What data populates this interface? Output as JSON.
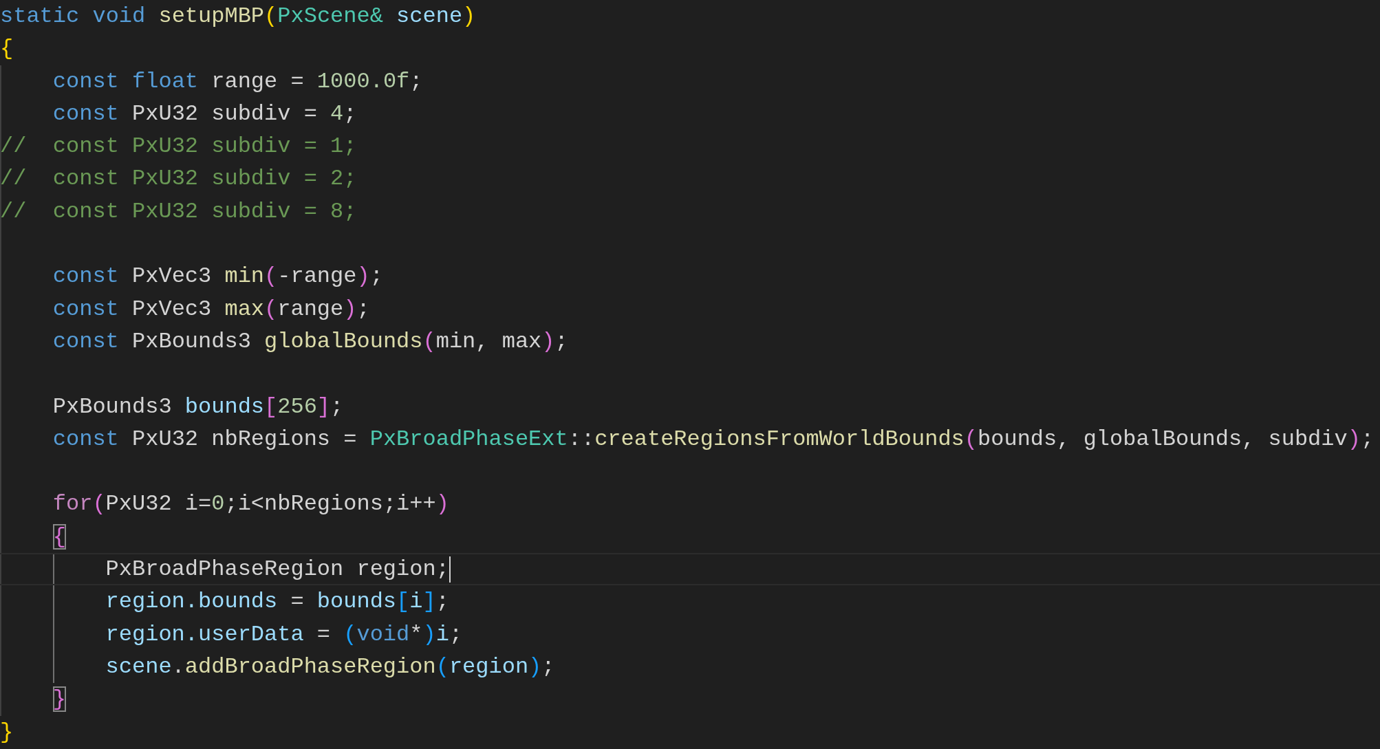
{
  "editor": {
    "lines": [
      {
        "kind": "code",
        "tokens": [
          {
            "kind": "keyword",
            "text": "static"
          },
          {
            "kind": "keyword",
            "text": " void"
          },
          {
            "kind": "function",
            "text": " setupMBP"
          },
          {
            "kind": "open",
            "text": "("
          },
          {
            "kind": "type",
            "text": "PxScene&"
          },
          {
            "kind": "variable",
            "text": " scene"
          },
          {
            "kind": "close",
            "text": ")"
          }
        ]
      },
      {
        "kind": "code",
        "tokens": [
          {
            "kind": "open",
            "text": "{"
          }
        ]
      },
      {
        "kind": "code",
        "tokens": [
          {
            "kind": "keyword",
            "text": "const"
          },
          {
            "kind": "keyword",
            "text": " float"
          },
          {
            "kind": "plain",
            "text": " range = "
          },
          {
            "kind": "number",
            "text": "1000.0f"
          },
          {
            "kind": "plain",
            "text": ";"
          }
        ]
      },
      {
        "kind": "code",
        "tokens": [
          {
            "kind": "keyword",
            "text": "const"
          },
          {
            "kind": "plain",
            "text": " PxU32 subdiv = "
          },
          {
            "kind": "number",
            "text": "4"
          },
          {
            "kind": "plain",
            "text": ";"
          }
        ]
      },
      {
        "kind": "comment",
        "text": "//  const PxU32 subdiv = 1;"
      },
      {
        "kind": "comment",
        "text": "//  const PxU32 subdiv = 2;"
      },
      {
        "kind": "comment",
        "text": "//  const PxU32 subdiv = 8;"
      },
      {
        "kind": "blank"
      },
      {
        "kind": "code",
        "tokens": [
          {
            "kind": "keyword",
            "text": "const"
          },
          {
            "kind": "plain",
            "text": " PxVec3 "
          },
          {
            "kind": "function",
            "text": "min"
          },
          {
            "kind": "open",
            "text": "("
          },
          {
            "kind": "plain",
            "text": "-range"
          },
          {
            "kind": "close",
            "text": ")"
          },
          {
            "kind": "plain",
            "text": ";"
          }
        ]
      },
      {
        "kind": "code",
        "tokens": [
          {
            "kind": "keyword",
            "text": "const"
          },
          {
            "kind": "plain",
            "text": " PxVec3 "
          },
          {
            "kind": "function",
            "text": "max"
          },
          {
            "kind": "open",
            "text": "("
          },
          {
            "kind": "plain",
            "text": "range"
          },
          {
            "kind": "close",
            "text": ")"
          },
          {
            "kind": "plain",
            "text": ";"
          }
        ]
      },
      {
        "kind": "code",
        "tokens": [
          {
            "kind": "keyword",
            "text": "const"
          },
          {
            "kind": "plain",
            "text": " PxBounds3 "
          },
          {
            "kind": "function",
            "text": "globalBounds"
          },
          {
            "kind": "open",
            "text": "("
          },
          {
            "kind": "plain",
            "text": "min, max"
          },
          {
            "kind": "close",
            "text": ")"
          },
          {
            "kind": "plain",
            "text": ";"
          }
        ]
      },
      {
        "kind": "blank"
      },
      {
        "kind": "code",
        "tokens": [
          {
            "kind": "plain",
            "text": "PxBounds3 "
          },
          {
            "kind": "variable",
            "text": "bounds"
          },
          {
            "kind": "open",
            "text": "["
          },
          {
            "kind": "number",
            "text": "256"
          },
          {
            "kind": "close",
            "text": "]"
          },
          {
            "kind": "plain",
            "text": ";"
          }
        ]
      },
      {
        "kind": "code",
        "tokens": [
          {
            "kind": "keyword",
            "text": "const"
          },
          {
            "kind": "plain",
            "text": " PxU32 nbRegions = "
          },
          {
            "kind": "type",
            "text": "PxBroadPhaseExt"
          },
          {
            "kind": "plain",
            "text": "::"
          },
          {
            "kind": "function",
            "text": "createRegionsFromWorldBounds"
          },
          {
            "kind": "open",
            "text": "("
          },
          {
            "kind": "plain",
            "text": "bounds, globalBounds, subdiv"
          },
          {
            "kind": "close",
            "text": ")"
          },
          {
            "kind": "plain",
            "text": ";"
          }
        ]
      },
      {
        "kind": "blank"
      },
      {
        "kind": "code",
        "tokens": [
          {
            "kind": "control",
            "text": "for"
          },
          {
            "kind": "open",
            "text": "("
          },
          {
            "kind": "plain",
            "text": "PxU32 i="
          },
          {
            "kind": "number",
            "text": "0"
          },
          {
            "kind": "plain",
            "text": ";i<nbRegions;i++"
          },
          {
            "kind": "close",
            "text": ")"
          }
        ]
      },
      {
        "kind": "code",
        "tokens": [
          {
            "kind": "open",
            "text": "{",
            "matched": true
          }
        ]
      },
      {
        "kind": "code",
        "current": true,
        "caret": true,
        "tokens": [
          {
            "kind": "plain",
            "text": "PxBroadPhaseRegion region;"
          }
        ]
      },
      {
        "kind": "code",
        "tokens": [
          {
            "kind": "variable",
            "text": "region.bounds"
          },
          {
            "kind": "plain",
            "text": " = "
          },
          {
            "kind": "variable",
            "text": "bounds"
          },
          {
            "kind": "open",
            "text": "["
          },
          {
            "kind": "variable",
            "text": "i"
          },
          {
            "kind": "close",
            "text": "]"
          },
          {
            "kind": "plain",
            "text": ";"
          }
        ]
      },
      {
        "kind": "code",
        "tokens": [
          {
            "kind": "variable",
            "text": "region.userData"
          },
          {
            "kind": "plain",
            "text": " = "
          },
          {
            "kind": "open",
            "text": "("
          },
          {
            "kind": "keyword",
            "text": "void"
          },
          {
            "kind": "plain",
            "text": "*"
          },
          {
            "kind": "close",
            "text": ")"
          },
          {
            "kind": "variable",
            "text": "i"
          },
          {
            "kind": "plain",
            "text": ";"
          }
        ]
      },
      {
        "kind": "code",
        "tokens": [
          {
            "kind": "variable",
            "text": "scene"
          },
          {
            "kind": "plain",
            "text": "."
          },
          {
            "kind": "function",
            "text": "addBroadPhaseRegion"
          },
          {
            "kind": "open",
            "text": "("
          },
          {
            "kind": "variable",
            "text": "region"
          },
          {
            "kind": "close",
            "text": ")"
          },
          {
            "kind": "plain",
            "text": ";"
          }
        ]
      },
      {
        "kind": "code",
        "tokens": [
          {
            "kind": "close",
            "text": "}",
            "matched": true
          }
        ]
      },
      {
        "kind": "code",
        "tokens": [
          {
            "kind": "close",
            "text": "}"
          }
        ]
      }
    ]
  }
}
